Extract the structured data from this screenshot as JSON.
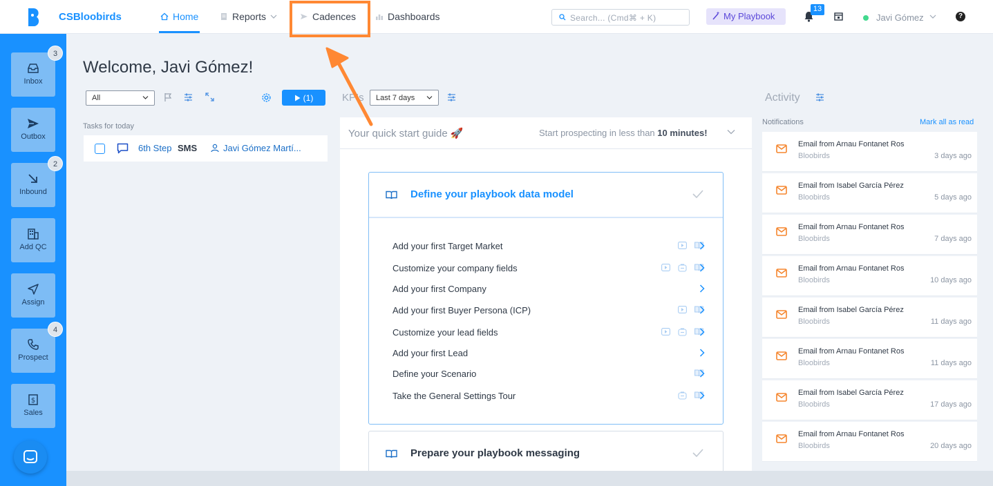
{
  "brand": {
    "name": "CSBloobirds",
    "color": "#1991ff"
  },
  "nav": {
    "home": "Home",
    "reports": "Reports",
    "cadences": "Cadences",
    "dashboards": "Dashboards"
  },
  "search": {
    "placeholder": "Search... (Cmd⌘ + K)"
  },
  "playbook_button": "My Playbook",
  "notifications_badge": "13",
  "user": {
    "name": "Javi Gómez"
  },
  "help": "?",
  "sidebar": {
    "items": [
      {
        "label": "Inbox",
        "icon": "inbox-icon",
        "badge": "3"
      },
      {
        "label": "Outbox",
        "icon": "send-icon",
        "badge": ""
      },
      {
        "label": "Inbound",
        "icon": "arrow-down-right-icon",
        "badge": "2"
      },
      {
        "label": "Add QC",
        "icon": "building-icon",
        "badge": ""
      },
      {
        "label": "Assign",
        "icon": "navigation-icon",
        "badge": ""
      },
      {
        "label": "Prospect",
        "icon": "phone-icon",
        "badge": "4"
      },
      {
        "label": "Sales",
        "icon": "dollar-icon",
        "badge": ""
      }
    ]
  },
  "welcome": "Welcome, Javi Gómez!",
  "tasks": {
    "filter_value": "All",
    "play_label": "(1)",
    "label": "Tasks for today",
    "items": [
      {
        "step": "6th Step",
        "type": "SMS",
        "person": "Javi Gómez Martí..."
      }
    ]
  },
  "kpis": {
    "label": "KPIs",
    "range": "Last 7 days"
  },
  "quick_start": {
    "title": "Your quick start guide 🚀",
    "subtitle_prefix": "Start prospecting in less than",
    "subtitle_bold": "10 minutes!",
    "card1": {
      "title": "Define your playbook data model",
      "steps": [
        "Add your first Target Market",
        "Customize your company fields",
        "Add your first Company",
        "Add your first Buyer Persona (ICP)",
        "Customize your lead fields",
        "Add your first Lead",
        "Define your Scenario",
        "Take the General Settings Tour"
      ]
    },
    "card2": {
      "title": "Prepare your playbook messaging"
    }
  },
  "activity": {
    "label": "Activity",
    "notifications_label": "Notifications",
    "mark_all": "Mark all as read",
    "items": [
      {
        "title": "Email from Arnau Fontanet Ros",
        "sub": "Bloobirds",
        "time": "3 days ago"
      },
      {
        "title": "Email from Isabel García Pérez",
        "sub": "Bloobirds",
        "time": "5 days ago"
      },
      {
        "title": "Email from Arnau Fontanet Ros",
        "sub": "Bloobirds",
        "time": "7 days ago"
      },
      {
        "title": "Email from Arnau Fontanet Ros",
        "sub": "Bloobirds",
        "time": "10 days ago"
      },
      {
        "title": "Email from Isabel García Pérez",
        "sub": "Bloobirds",
        "time": "11 days ago"
      },
      {
        "title": "Email from Arnau Fontanet Ros",
        "sub": "Bloobirds",
        "time": "11 days ago"
      },
      {
        "title": "Email from Isabel García Pérez",
        "sub": "Bloobirds",
        "time": "17 days ago"
      },
      {
        "title": "Email from Arnau Fontanet Ros",
        "sub": "Bloobirds",
        "time": "20 days ago"
      }
    ]
  },
  "colors": {
    "accent": "#1991ff",
    "highlight": "#ff8833",
    "notification_icon": "#f5862e"
  }
}
